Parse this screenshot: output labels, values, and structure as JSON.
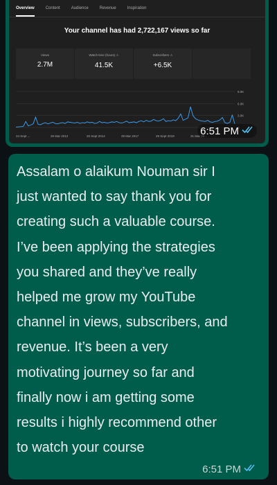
{
  "image_message": {
    "screenshot": {
      "tabs": [
        "Overview",
        "Content",
        "Audience",
        "Revenue",
        "Inspiration"
      ],
      "active_tab": "Overview",
      "headline": "Your channel has had 2,722,167 views so far",
      "metrics": [
        {
          "label": "Views",
          "value": "2.7M"
        },
        {
          "label": "Watch time (hours) ⚠",
          "value": "41.5K"
        },
        {
          "label": "Subscribers ⚠",
          "value": "+6.5K"
        }
      ]
    },
    "time": "6:51 PM",
    "read_icon": "double-check-icon"
  },
  "text_message": {
    "text": "Assalam o alaikum Nouman sir I\njust wanted to say thank you for\ncreating such a valuable course.\nI’ve been applying the strategies\nyou shared and they’ve really\nhelped me grow my YouTube\nchannel in views, subscribers, and\nrevenue. It’s been a very\nmotivating journey so far and\nfinally now i am getting some\nresults i highly recommend other\nto watch your course",
    "time": "6:51 PM",
    "read_icon": "double-check-icon"
  },
  "colors": {
    "bubble": "#005c4b",
    "background": "#0b1115",
    "chart_line": "#3ea6ff",
    "read_ticks": "#53bdeb"
  },
  "chart_data": {
    "type": "line",
    "x_ticks": [
      "24 Sept ...",
      "26 Mar 2012",
      "26 Sept 2014",
      "29 Mar 2017",
      "29 Sept 2019",
      "31 Mar 20..."
    ],
    "y_ticks": [
      "9.0K",
      "6.0K",
      "3.0K",
      "0"
    ],
    "ylim": [
      0,
      9000
    ],
    "values": [
      100,
      150,
      200,
      300,
      1500,
      400,
      600,
      900,
      2600,
      800,
      700,
      1000,
      1200,
      900,
      1100,
      1300,
      1000,
      900,
      1100,
      1200,
      1000,
      1400,
      1300,
      1200,
      1100,
      1300,
      1000,
      1200,
      1100,
      1400,
      1200,
      1300,
      1000,
      1100,
      1500,
      1200,
      1300,
      1100,
      1200,
      1400,
      1300,
      1500,
      1200,
      1100,
      1300,
      1600,
      1200,
      1300,
      1400,
      1200,
      1500,
      1700,
      1400,
      1800,
      1500,
      1600,
      2000,
      1700,
      1600,
      1800,
      2200,
      1500,
      1700,
      1600,
      1900,
      1700,
      2300,
      3400,
      1800,
      2100,
      2400,
      5200,
      3000,
      2200,
      1900,
      1700,
      1600,
      1500,
      1800,
      1400,
      1300,
      1500,
      1600,
      1900,
      2500,
      1200,
      1000,
      1300,
      3100,
      900
    ]
  }
}
